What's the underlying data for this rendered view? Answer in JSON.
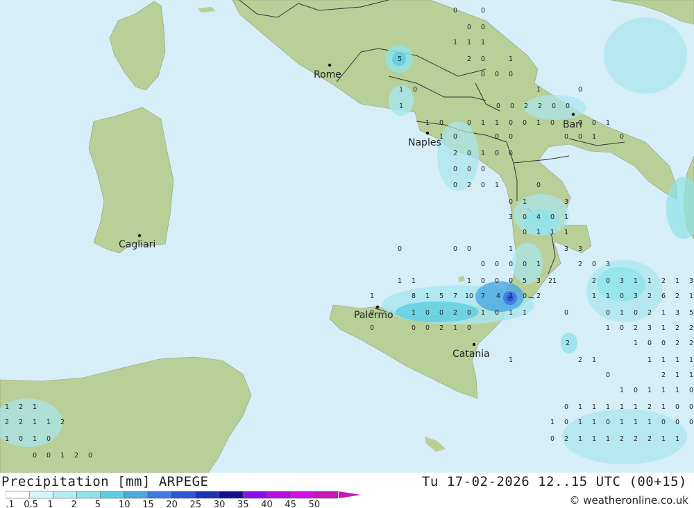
{
  "map": {
    "colors": {
      "sea": "#d6eef8",
      "land": "#b8cf98",
      "border": "#333333",
      "precip_light": "#a8e6ef",
      "precip_mid": "#7dd4e8",
      "precip_heavy": "#4a78e0"
    },
    "cities": [
      {
        "name": "Rome",
        "icon": "city-dot-icon"
      },
      {
        "name": "Naples",
        "icon": "city-dot-icon"
      },
      {
        "name": "Bari",
        "icon": "city-dot-icon"
      },
      {
        "name": "Cagliari",
        "icon": "city-dot-icon"
      },
      {
        "name": "Palermo",
        "icon": "city-dot-icon"
      },
      {
        "name": "Catania",
        "icon": "city-dot-icon"
      }
    ],
    "values": [
      "0",
      "0",
      "0",
      "0",
      "1",
      "1",
      "1",
      "5",
      "2",
      "0",
      "1",
      "0",
      "0",
      "0",
      "1",
      "0",
      "1",
      "0",
      "0",
      "0",
      "2",
      "2",
      "0",
      "0",
      "1",
      "1",
      "0",
      "0",
      "1",
      "1",
      "0",
      "0",
      "1",
      "0",
      "0",
      "0",
      "1",
      "1",
      "0",
      "0",
      "0",
      "0",
      "0",
      "1",
      "0",
      "2",
      "0",
      "1",
      "0",
      "0",
      "0",
      "0",
      "0",
      "0",
      "2",
      "0",
      "1",
      "0",
      "0",
      "1",
      "3",
      "3",
      "0",
      "4",
      "0",
      "1",
      "0",
      "1",
      "1",
      "1",
      "0",
      "0",
      "0",
      "1",
      "3",
      "3",
      "0",
      "0",
      "0",
      "0",
      "1",
      "2",
      "0",
      "3",
      "1",
      "1",
      "1",
      "0",
      "0",
      "0",
      "5",
      "3",
      "21",
      "8",
      "1",
      "5",
      "7",
      "10",
      "7",
      "4",
      "2",
      "0",
      "2",
      "1",
      "0",
      "0",
      "2",
      "0",
      "1",
      "0",
      "1",
      "1",
      "0",
      "0",
      "2",
      "1",
      "0",
      "1",
      "0",
      "0",
      "0",
      "2",
      "2",
      "1",
      "0",
      "1",
      "2",
      "0",
      "3",
      "1",
      "1",
      "2",
      "1",
      "3",
      "1",
      "1",
      "0",
      "3",
      "2",
      "6",
      "2",
      "1",
      "0",
      "1",
      "0",
      "2",
      "1",
      "3",
      "5",
      "1",
      "0",
      "2",
      "3",
      "1",
      "2",
      "2",
      "1",
      "0",
      "0",
      "2",
      "2",
      "1",
      "1",
      "1",
      "1",
      "2",
      "1",
      "1",
      "1",
      "0",
      "1",
      "1",
      "1",
      "0",
      "0",
      "1",
      "1",
      "1",
      "1",
      "1",
      "2",
      "1",
      "0",
      "0",
      "1",
      "0",
      "1",
      "1",
      "0",
      "1",
      "1",
      "1",
      "0",
      "0",
      "0",
      "0",
      "2",
      "1",
      "1",
      "1",
      "2",
      "2",
      "2",
      "1",
      "1",
      "1",
      "2",
      "1",
      "2",
      "2",
      "1",
      "1",
      "2",
      "1",
      "0",
      "1",
      "0",
      "0",
      "0",
      "1",
      "2",
      "0",
      "1",
      "0",
      "0",
      "0",
      "0",
      "0",
      "0",
      "0",
      "0",
      "0",
      "0",
      "0"
    ]
  },
  "footer": {
    "title": "Precipitation [mm] ARPEGE",
    "valid_time": "Tu 17-02-2026 12..15 UTC (00+15)",
    "copyright": "© weatheronline.co.uk"
  },
  "legend": {
    "labels": [
      "0.1",
      "0.5",
      "1",
      "2",
      "5",
      "10",
      "15",
      "20",
      "25",
      "30",
      "35",
      "40",
      "45",
      "50"
    ],
    "colors": [
      "#ffffff",
      "#d6f5f8",
      "#b5eef2",
      "#8fe3ea",
      "#5fcde3",
      "#4aa8e4",
      "#3f7be0",
      "#2f55d6",
      "#1e33b4",
      "#150f8c",
      "#8a10e6",
      "#b80fe0",
      "#d510e6",
      "#c618b8"
    ]
  }
}
